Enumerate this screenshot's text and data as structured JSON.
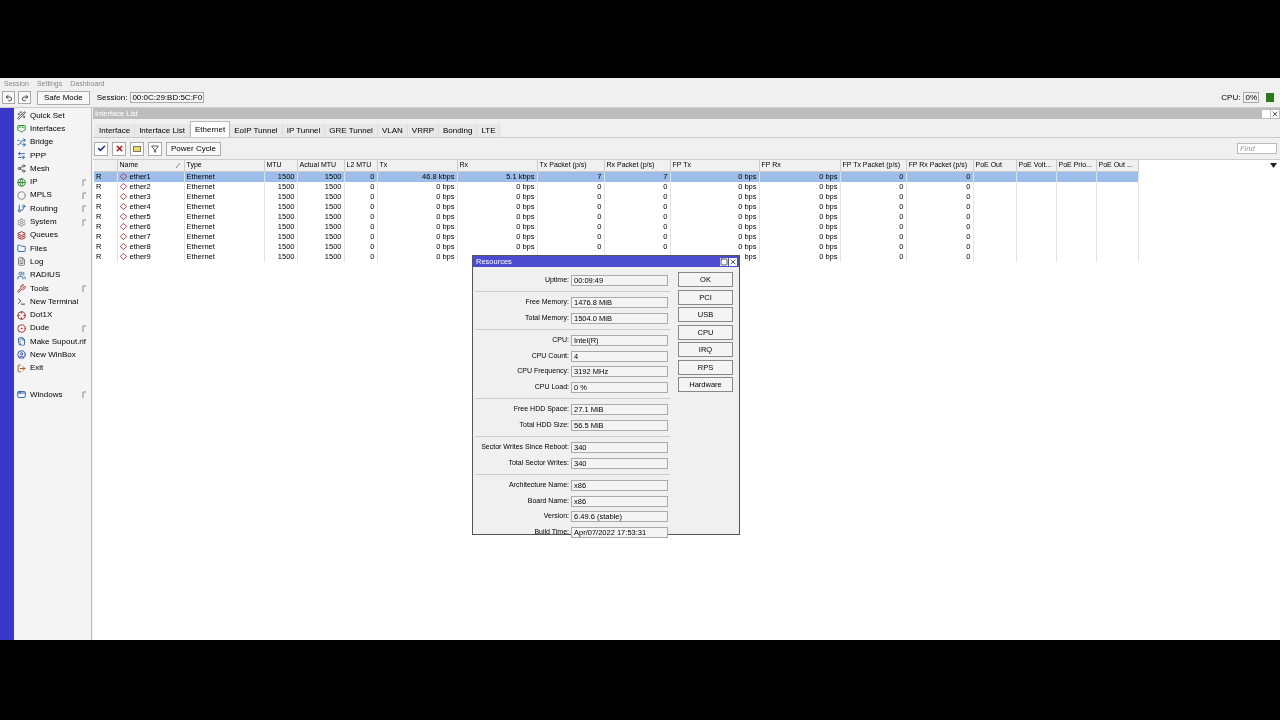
{
  "menu": [
    "Session",
    "Settings",
    "Dashboard"
  ],
  "toolbar": {
    "safe_mode": "Safe Mode",
    "session_label": "Session:",
    "session_value": "00:0C:29:BD:5C:F0",
    "cpu_label": "CPU:",
    "cpu_value": "0%"
  },
  "sidebar": {
    "items": [
      {
        "label": "Quick Set",
        "submenu": false
      },
      {
        "label": "Interfaces",
        "submenu": false
      },
      {
        "label": "Bridge",
        "submenu": false
      },
      {
        "label": "PPP",
        "submenu": false
      },
      {
        "label": "Mesh",
        "submenu": false
      },
      {
        "label": "IP",
        "submenu": true
      },
      {
        "label": "MPLS",
        "submenu": true
      },
      {
        "label": "Routing",
        "submenu": true
      },
      {
        "label": "System",
        "submenu": true
      },
      {
        "label": "Queues",
        "submenu": false
      },
      {
        "label": "Files",
        "submenu": false
      },
      {
        "label": "Log",
        "submenu": false
      },
      {
        "label": "RADIUS",
        "submenu": false
      },
      {
        "label": "Tools",
        "submenu": true
      },
      {
        "label": "New Terminal",
        "submenu": false
      },
      {
        "label": "Dot1X",
        "submenu": false
      },
      {
        "label": "Dude",
        "submenu": true
      },
      {
        "label": "Make Supout.rif",
        "submenu": false
      },
      {
        "label": "New WinBox",
        "submenu": false
      },
      {
        "label": "Exit",
        "submenu": false
      }
    ],
    "bottom_items": [
      {
        "label": "Windows",
        "submenu": true
      }
    ]
  },
  "window": {
    "title": "Interface List",
    "tabs": [
      {
        "label": "Interface",
        "selected": false
      },
      {
        "label": "Interface List",
        "selected": false
      },
      {
        "label": "Ethernet",
        "selected": true
      },
      {
        "label": "EoIP Tunnel",
        "selected": false
      },
      {
        "label": "IP Tunnel",
        "selected": false
      },
      {
        "label": "GRE Tunnel",
        "selected": false
      },
      {
        "label": "VLAN",
        "selected": false
      },
      {
        "label": "VRRP",
        "selected": false
      },
      {
        "label": "Bonding",
        "selected": false
      },
      {
        "label": "LTE",
        "selected": false
      }
    ],
    "power_cycle": "Power Cycle",
    "find_placeholder": "Find",
    "table": {
      "columns": [
        "",
        "Name",
        "Type",
        "MTU",
        "Actual MTU",
        "L2 MTU",
        "Tx",
        "Rx",
        "Tx Packet (p/s)",
        "Rx Packet (p/s)",
        "FP Tx",
        "FP Rx",
        "FP Tx Packet (p/s)",
        "FP Rx Packet (p/s)",
        "PoE Out",
        "PoE Volt...",
        "PoE Prio...",
        "PoE Out ..."
      ],
      "rows": [
        {
          "selected": true,
          "cells": [
            "R",
            "ether1",
            "Ethernet",
            "1500",
            "1500",
            "0",
            "46.8 kbps",
            "5.1 kbps",
            "7",
            "7",
            "0 bps",
            "0 bps",
            "0",
            "0"
          ]
        },
        {
          "selected": false,
          "cells": [
            "R",
            "ether2",
            "Ethernet",
            "1500",
            "1500",
            "0",
            "0 bps",
            "0 bps",
            "0",
            "0",
            "0 bps",
            "0 bps",
            "0",
            "0"
          ]
        },
        {
          "selected": false,
          "cells": [
            "R",
            "ether3",
            "Ethernet",
            "1500",
            "1500",
            "0",
            "0 bps",
            "0 bps",
            "0",
            "0",
            "0 bps",
            "0 bps",
            "0",
            "0"
          ]
        },
        {
          "selected": false,
          "cells": [
            "R",
            "ether4",
            "Ethernet",
            "1500",
            "1500",
            "0",
            "0 bps",
            "0 bps",
            "0",
            "0",
            "0 bps",
            "0 bps",
            "0",
            "0"
          ]
        },
        {
          "selected": false,
          "cells": [
            "R",
            "ether5",
            "Ethernet",
            "1500",
            "1500",
            "0",
            "0 bps",
            "0 bps",
            "0",
            "0",
            "0 bps",
            "0 bps",
            "0",
            "0"
          ]
        },
        {
          "selected": false,
          "cells": [
            "R",
            "ether6",
            "Ethernet",
            "1500",
            "1500",
            "0",
            "0 bps",
            "0 bps",
            "0",
            "0",
            "0 bps",
            "0 bps",
            "0",
            "0"
          ]
        },
        {
          "selected": false,
          "cells": [
            "R",
            "ether7",
            "Ethernet",
            "1500",
            "1500",
            "0",
            "0 bps",
            "0 bps",
            "0",
            "0",
            "0 bps",
            "0 bps",
            "0",
            "0"
          ]
        },
        {
          "selected": false,
          "cells": [
            "R",
            "ether8",
            "Ethernet",
            "1500",
            "1500",
            "0",
            "0 bps",
            "0 bps",
            "0",
            "0",
            "0 bps",
            "0 bps",
            "0",
            "0"
          ]
        },
        {
          "selected": false,
          "cells": [
            "R",
            "ether9",
            "Ethernet",
            "1500",
            "1500",
            "0",
            "0 bps",
            null,
            null,
            null,
            "bps",
            "0 bps",
            "0",
            "0"
          ]
        }
      ]
    }
  },
  "dialog": {
    "title": "Resources",
    "groups": [
      [
        {
          "label": "Uptime:",
          "value": "00:09:49"
        }
      ],
      [
        {
          "label": "Free Memory:",
          "value": "1476.8 MiB"
        },
        {
          "label": "Total Memory:",
          "value": "1504.0 MiB"
        }
      ],
      [
        {
          "label": "CPU:",
          "value": "Intel(R)"
        },
        {
          "label": "CPU Count:",
          "value": "4"
        },
        {
          "label": "CPU Frequency:",
          "value": "3192 MHz"
        },
        {
          "label": "CPU Load:",
          "value": "0 %"
        }
      ],
      [
        {
          "label": "Free HDD Space:",
          "value": "27.1 MiB"
        },
        {
          "label": "Total HDD Size:",
          "value": "56.5 MiB"
        }
      ],
      [
        {
          "label": "Sector Writes Since Reboot:",
          "value": "340"
        },
        {
          "label": "Total Sector Writes:",
          "value": "340"
        }
      ],
      [
        {
          "label": "Architecture Name:",
          "value": "x86"
        },
        {
          "label": "Board Name:",
          "value": "x86"
        },
        {
          "label": "Version:",
          "value": "6.49.6 (stable)"
        },
        {
          "label": "Build Time:",
          "value": "Apr/07/2022 17:53:31"
        }
      ]
    ],
    "buttons": [
      "OK",
      "PCI",
      "USB",
      "CPU",
      "IRQ",
      "RPS",
      "Hardware"
    ]
  }
}
